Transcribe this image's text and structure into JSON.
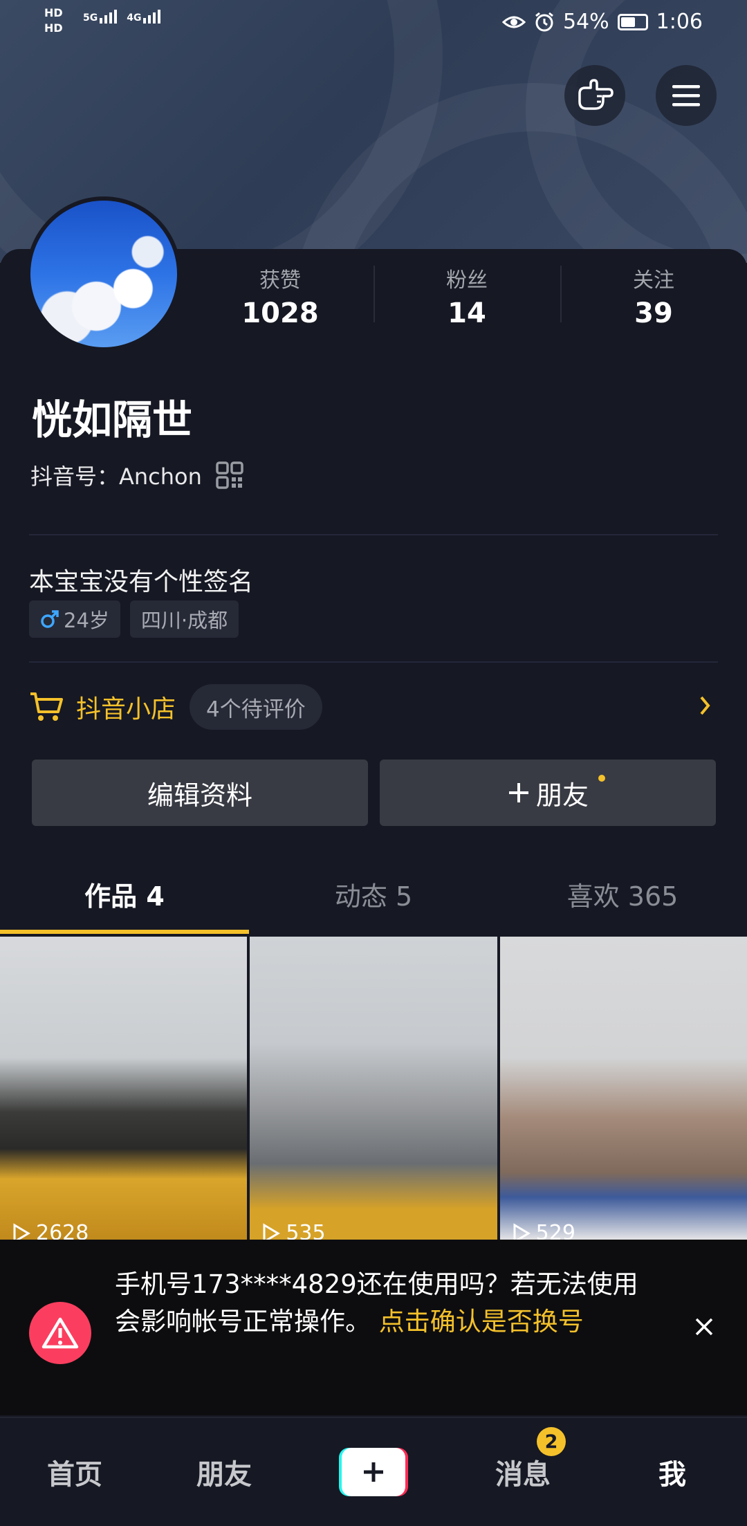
{
  "status_bar": {
    "hd1": "HD",
    "hd2": "HD",
    "net1": "5G",
    "net2": "4G",
    "battery_pct": "54%",
    "time": "1:06",
    "battery_level": 0.54
  },
  "profile": {
    "stats": [
      {
        "label": "获赞",
        "value": "1028"
      },
      {
        "label": "粉丝",
        "value": "14"
      },
      {
        "label": "关注",
        "value": "39"
      }
    ],
    "nickname": "恍如隔世",
    "douyin_id": "抖音号：Anchon",
    "bio": "本宝宝没有个性签名",
    "tags": {
      "age": "24岁",
      "location": "四川·成都"
    }
  },
  "shop": {
    "title": "抖音小店",
    "badge": "4个待评价"
  },
  "actions": {
    "edit": "编辑资料",
    "add_friend": "朋友"
  },
  "tabs": [
    {
      "label": "作品 4"
    },
    {
      "label": "动态 5"
    },
    {
      "label": "喜欢 365"
    }
  ],
  "videos": [
    {
      "plays": "2628"
    },
    {
      "plays": "535"
    },
    {
      "plays": "529"
    }
  ],
  "notice": {
    "text": "手机号173****4829还在使用吗？若无法使用会影响帐号正常操作。",
    "link": "点击确认是否换号"
  },
  "bottom_nav": {
    "home": "首页",
    "friends": "朋友",
    "messages": "消息",
    "messages_badge": "2",
    "me": "我"
  },
  "colors": {
    "accent": "#f4c12b",
    "background": "#161823",
    "alert": "#fb3e5f"
  }
}
